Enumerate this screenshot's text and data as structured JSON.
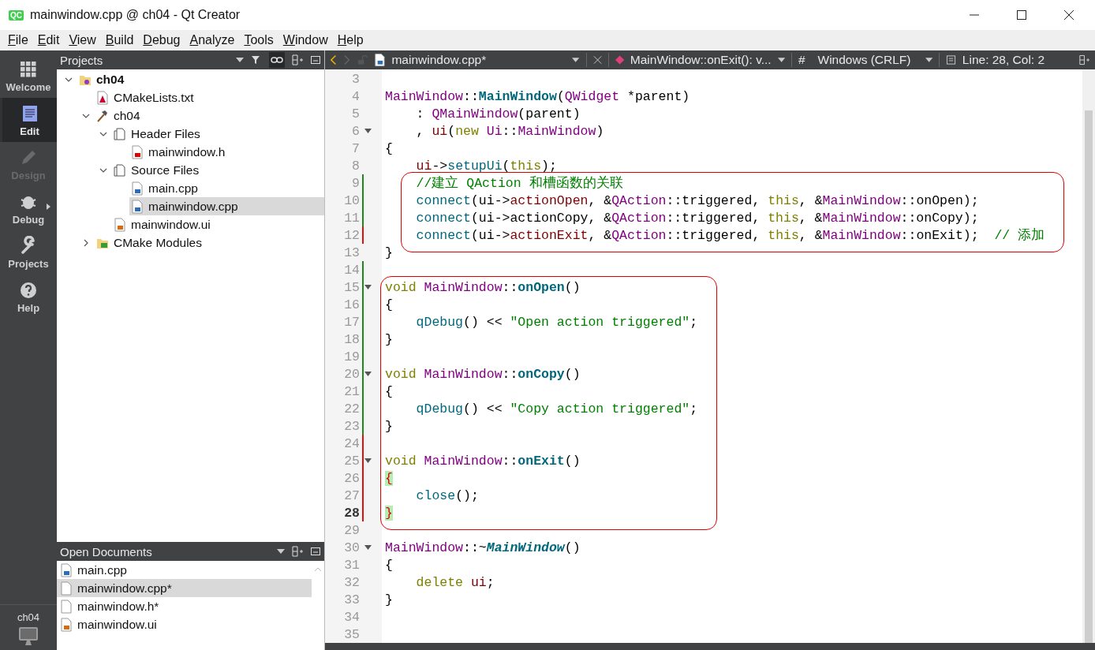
{
  "window": {
    "logo": "QC",
    "title": "mainwindow.cpp @ ch04 - Qt Creator"
  },
  "menu": [
    "File",
    "Edit",
    "View",
    "Build",
    "Debug",
    "Analyze",
    "Tools",
    "Window",
    "Help"
  ],
  "modes": [
    {
      "label": "Welcome",
      "kind": "welcome",
      "selected": false,
      "disabled": false
    },
    {
      "label": "Edit",
      "kind": "edit",
      "selected": true,
      "disabled": false
    },
    {
      "label": "Design",
      "kind": "design",
      "selected": false,
      "disabled": true
    },
    {
      "label": "Debug",
      "kind": "debug",
      "selected": false,
      "disabled": false
    },
    {
      "label": "Projects",
      "kind": "projects",
      "selected": false,
      "disabled": false
    },
    {
      "label": "Help",
      "kind": "help",
      "selected": false,
      "disabled": false
    }
  ],
  "kit": {
    "label": "ch04"
  },
  "projects": {
    "title": "Projects",
    "tree": [
      {
        "label": "ch04",
        "kind": "project",
        "expanded": true,
        "selected": false,
        "children": [
          {
            "label": "CMakeLists.txt",
            "kind": "cmake",
            "selected": false
          },
          {
            "label": "ch04",
            "kind": "target",
            "expanded": true,
            "selected": false,
            "children": [
              {
                "label": "Header Files",
                "kind": "folder",
                "expanded": true,
                "selected": false,
                "children": [
                  {
                    "label": "mainwindow.h",
                    "kind": "header",
                    "selected": false
                  }
                ]
              },
              {
                "label": "Source Files",
                "kind": "folder",
                "expanded": true,
                "selected": false,
                "children": [
                  {
                    "label": "main.cpp",
                    "kind": "source",
                    "selected": false
                  },
                  {
                    "label": "mainwindow.cpp",
                    "kind": "source",
                    "selected": true
                  }
                ]
              },
              {
                "label": "mainwindow.ui",
                "kind": "form",
                "selected": false
              }
            ]
          },
          {
            "label": "CMake Modules",
            "kind": "modules",
            "expanded": false,
            "selected": false
          }
        ]
      }
    ]
  },
  "open_documents": {
    "title": "Open Documents",
    "items": [
      {
        "label": "main.cpp",
        "kind": "source",
        "selected": false
      },
      {
        "label": "mainwindow.cpp*",
        "kind": "plain",
        "selected": true
      },
      {
        "label": "mainwindow.h*",
        "kind": "plain",
        "selected": false
      },
      {
        "label": "mainwindow.ui",
        "kind": "form",
        "selected": false
      }
    ]
  },
  "editor_toolbar": {
    "file": "mainwindow.cpp*",
    "symbol": "MainWindow::onExit(): v...",
    "hash": "#",
    "line_ending": "Windows (CRLF)",
    "position": "Line: 28, Col: 2"
  },
  "editor": {
    "blocks": [
      {
        "boxed": false,
        "lines": [
          {
            "n": "3"
          },
          {
            "n": "4",
            "tokens": [
              {
                "kind": "type",
                "text": "MainWindow"
              },
              {
                "kind": "plain",
                "text": "::"
              },
              {
                "kind": "decl",
                "text": "MainWindow"
              },
              {
                "kind": "plain",
                "text": "("
              },
              {
                "kind": "type",
                "text": "QWidget"
              },
              {
                "kind": "plain",
                "text": " *parent)"
              }
            ]
          },
          {
            "n": "5",
            "tokens": [
              {
                "kind": "plain",
                "text": "    : "
              },
              {
                "kind": "type",
                "text": "QMainWindow"
              },
              {
                "kind": "plain",
                "text": "(parent)"
              }
            ]
          },
          {
            "n": "6",
            "fold": true,
            "tokens": [
              {
                "kind": "plain",
                "text": "    , "
              },
              {
                "kind": "member",
                "text": "ui"
              },
              {
                "kind": "plain",
                "text": "("
              },
              {
                "kind": "keyword",
                "text": "new "
              },
              {
                "kind": "type",
                "text": "Ui"
              },
              {
                "kind": "plain",
                "text": "::"
              },
              {
                "kind": "type",
                "text": "MainWindow"
              },
              {
                "kind": "plain",
                "text": ")"
              }
            ]
          },
          {
            "n": "7",
            "tokens": [
              {
                "kind": "plain",
                "text": "{"
              }
            ]
          },
          {
            "n": "8",
            "tokens": [
              {
                "kind": "member",
                "text": "    ui"
              },
              {
                "kind": "plain",
                "text": "->"
              },
              {
                "kind": "call",
                "text": "setupUi"
              },
              {
                "kind": "plain",
                "text": "("
              },
              {
                "kind": "keyword",
                "text": "this"
              },
              {
                "kind": "plain",
                "text": ");"
              }
            ]
          }
        ]
      },
      {
        "boxed": true,
        "lines": [
          {
            "n": "9",
            "changed": true,
            "saved": true,
            "tokens": [
              {
                "kind": "comment",
                "text": "    //建立 QAction 和槽函数的关联"
              }
            ]
          },
          {
            "n": "10",
            "changed": true,
            "saved": true,
            "tokens": [
              {
                "kind": "call",
                "text": "    connect"
              },
              {
                "kind": "plain",
                "text": "(ui->"
              },
              {
                "kind": "member",
                "text": "actionOpen"
              },
              {
                "kind": "plain",
                "text": ", &"
              },
              {
                "kind": "type",
                "text": "QAction"
              },
              {
                "kind": "plain",
                "text": "::triggered, "
              },
              {
                "kind": "keyword",
                "text": "this"
              },
              {
                "kind": "plain",
                "text": ", &"
              },
              {
                "kind": "type",
                "text": "MainWindow"
              },
              {
                "kind": "plain",
                "text": "::onOpen);"
              }
            ]
          },
          {
            "n": "11",
            "changed": true,
            "saved": true,
            "tokens": [
              {
                "kind": "call",
                "text": "    connect"
              },
              {
                "kind": "plain",
                "text": "(ui->actionCopy, &"
              },
              {
                "kind": "type",
                "text": "QAction"
              },
              {
                "kind": "plain",
                "text": "::triggered, "
              },
              {
                "kind": "keyword",
                "text": "this"
              },
              {
                "kind": "plain",
                "text": ", &"
              },
              {
                "kind": "type",
                "text": "MainWindow"
              },
              {
                "kind": "plain",
                "text": "::onCopy);"
              }
            ]
          },
          {
            "n": "12",
            "changed": true,
            "saved": false,
            "tokens": [
              {
                "kind": "call",
                "text": "    connect"
              },
              {
                "kind": "plain",
                "text": "(ui->"
              },
              {
                "kind": "member",
                "text": "actionExit"
              },
              {
                "kind": "plain",
                "text": ", &"
              },
              {
                "kind": "type",
                "text": "QAction"
              },
              {
                "kind": "plain",
                "text": "::triggered, "
              },
              {
                "kind": "keyword",
                "text": "this"
              },
              {
                "kind": "plain",
                "text": ", &"
              },
              {
                "kind": "type",
                "text": "MainWindow"
              },
              {
                "kind": "plain",
                "text": "::onExit);"
              },
              {
                "kind": "comment",
                "text": "  // 添加"
              }
            ]
          }
        ]
      },
      {
        "boxed": false,
        "lines": [
          {
            "n": "13",
            "tokens": [
              {
                "kind": "plain",
                "text": "}"
              }
            ]
          },
          {
            "n": "14",
            "changed": true,
            "saved": true
          }
        ]
      },
      {
        "boxed": true,
        "lines": [
          {
            "n": "15",
            "changed": true,
            "saved": true,
            "fold": true,
            "tokens": [
              {
                "kind": "keyword",
                "text": "void "
              },
              {
                "kind": "type",
                "text": "MainWindow"
              },
              {
                "kind": "plain",
                "text": "::"
              },
              {
                "kind": "decl",
                "text": "onOpen"
              },
              {
                "kind": "plain",
                "text": "()"
              }
            ]
          },
          {
            "n": "16",
            "changed": true,
            "saved": true,
            "tokens": [
              {
                "kind": "plain",
                "text": "{"
              }
            ]
          },
          {
            "n": "17",
            "changed": true,
            "saved": true,
            "tokens": [
              {
                "kind": "call",
                "text": "    qDebug"
              },
              {
                "kind": "plain",
                "text": "() << "
              },
              {
                "kind": "string",
                "text": "\"Open action triggered\""
              },
              {
                "kind": "plain",
                "text": ";"
              }
            ]
          },
          {
            "n": "18",
            "changed": true,
            "saved": true,
            "tokens": [
              {
                "kind": "plain",
                "text": "}"
              }
            ]
          },
          {
            "n": "19",
            "changed": true,
            "saved": true
          },
          {
            "n": "20",
            "changed": true,
            "saved": true,
            "fold": true,
            "tokens": [
              {
                "kind": "keyword",
                "text": "void "
              },
              {
                "kind": "type",
                "text": "MainWindow"
              },
              {
                "kind": "plain",
                "text": "::"
              },
              {
                "kind": "decl",
                "text": "onCopy"
              },
              {
                "kind": "plain",
                "text": "()"
              }
            ]
          },
          {
            "n": "21",
            "changed": true,
            "saved": true,
            "tokens": [
              {
                "kind": "plain",
                "text": "{"
              }
            ]
          },
          {
            "n": "22",
            "changed": true,
            "saved": true,
            "tokens": [
              {
                "kind": "call",
                "text": "    qDebug"
              },
              {
                "kind": "plain",
                "text": "() << "
              },
              {
                "kind": "string",
                "text": "\"Copy action triggered\""
              },
              {
                "kind": "plain",
                "text": ";"
              }
            ]
          },
          {
            "n": "23",
            "changed": true,
            "saved": true,
            "tokens": [
              {
                "kind": "plain",
                "text": "}"
              }
            ]
          },
          {
            "n": "24",
            "changed": true,
            "saved": false
          },
          {
            "n": "25",
            "changed": true,
            "saved": false,
            "fold": true,
            "tokens": [
              {
                "kind": "keyword",
                "text": "void "
              },
              {
                "kind": "type",
                "text": "MainWindow"
              },
              {
                "kind": "plain",
                "text": "::"
              },
              {
                "kind": "decl",
                "text": "onExit"
              },
              {
                "kind": "plain",
                "text": "()"
              }
            ]
          },
          {
            "n": "26",
            "changed": true,
            "saved": false,
            "tokens": [
              {
                "kind": "brace",
                "text": "{"
              }
            ]
          },
          {
            "n": "27",
            "changed": true,
            "saved": false,
            "tokens": [
              {
                "kind": "call",
                "text": "    close"
              },
              {
                "kind": "plain",
                "text": "();"
              }
            ]
          },
          {
            "n": "28",
            "changed": true,
            "saved": false,
            "current": true,
            "tokens": [
              {
                "kind": "brace",
                "text": "}"
              }
            ]
          }
        ]
      },
      {
        "boxed": false,
        "lines": [
          {
            "n": "29"
          },
          {
            "n": "30",
            "fold": true,
            "tokens": [
              {
                "kind": "type",
                "text": "MainWindow"
              },
              {
                "kind": "plain",
                "text": "::~"
              },
              {
                "kind": "decl_virtual",
                "text": "MainWindow"
              },
              {
                "kind": "plain",
                "text": "()"
              }
            ]
          },
          {
            "n": "31",
            "tokens": [
              {
                "kind": "plain",
                "text": "{"
              }
            ]
          },
          {
            "n": "32",
            "tokens": [
              {
                "kind": "keyword",
                "text": "    delete "
              },
              {
                "kind": "member",
                "text": "ui"
              },
              {
                "kind": "plain",
                "text": ";"
              }
            ]
          },
          {
            "n": "33",
            "tokens": [
              {
                "kind": "plain",
                "text": "}"
              }
            ]
          },
          {
            "n": "34"
          },
          {
            "n": "35"
          }
        ]
      }
    ]
  }
}
